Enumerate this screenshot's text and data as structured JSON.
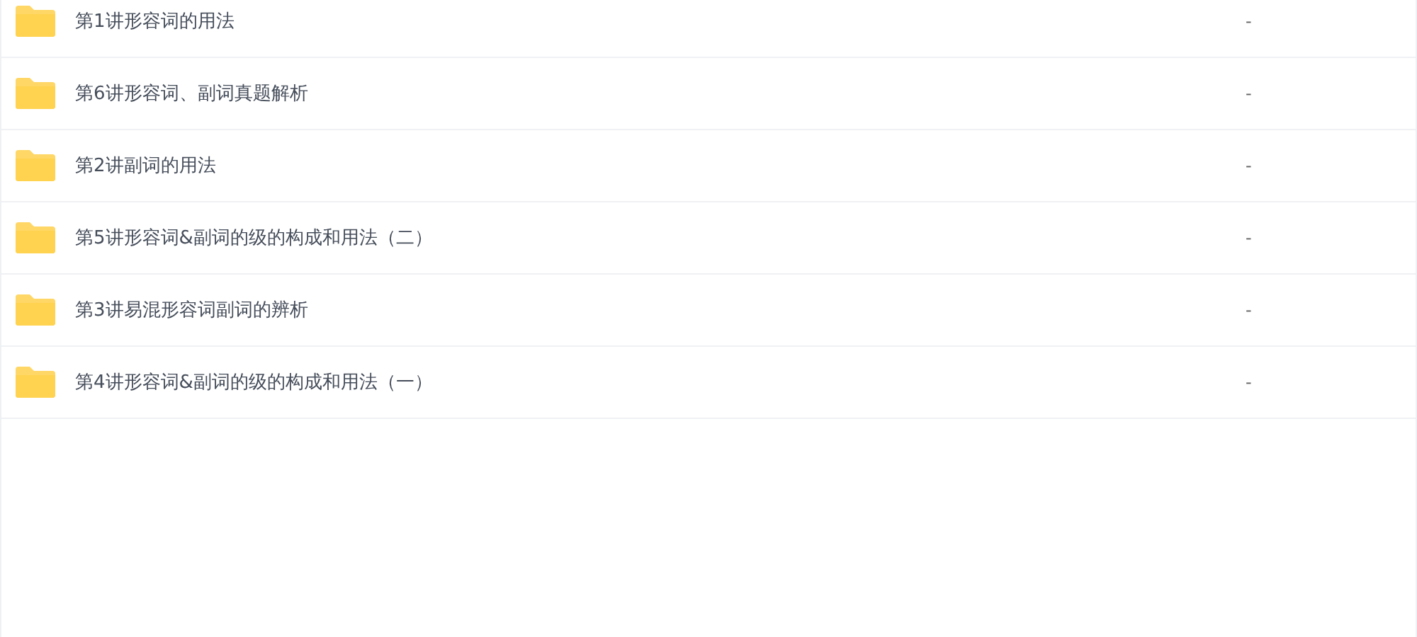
{
  "files": [
    {
      "name": "第1讲形容词的用法",
      "column_2": "-"
    },
    {
      "name": "第6讲形容词、副词真题解析",
      "column_2": "-"
    },
    {
      "name": "第2讲副词的用法",
      "column_2": "-"
    },
    {
      "name": "第5讲形容词&副词的级的构成和用法（二）",
      "column_2": "-"
    },
    {
      "name": "第3讲易混形容词副词的辨析",
      "column_2": "-"
    },
    {
      "name": "第4讲形容词&副词的级的构成和用法（一）",
      "column_2": "-"
    }
  ]
}
